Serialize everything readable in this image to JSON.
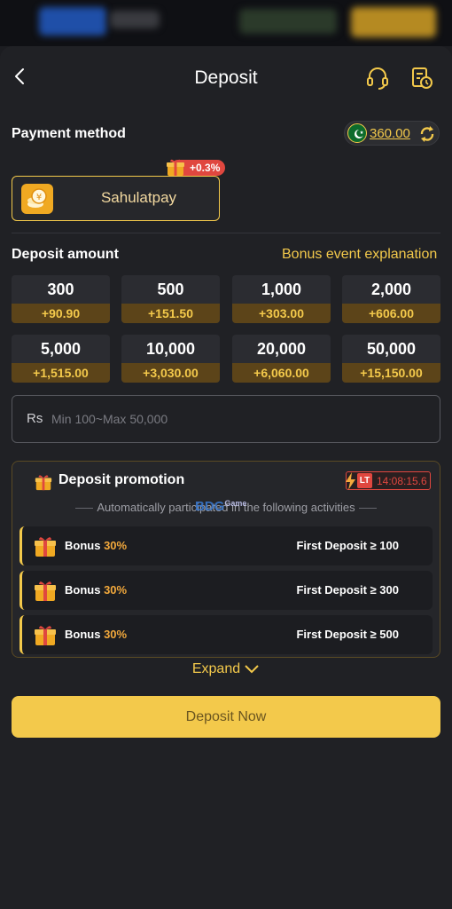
{
  "header": {
    "title": "Deposit"
  },
  "payment": {
    "section_title": "Payment method",
    "balance": "360.00",
    "method_name": "Sahulatpay",
    "rate_badge": "+0.3%"
  },
  "amounts": {
    "section_title": "Deposit amount",
    "bonus_link": "Bonus event explanation",
    "options": [
      {
        "amount": "300",
        "bonus": "+90.90"
      },
      {
        "amount": "500",
        "bonus": "+151.50"
      },
      {
        "amount": "1,000",
        "bonus": "+303.00"
      },
      {
        "amount": "2,000",
        "bonus": "+606.00"
      },
      {
        "amount": "5,000",
        "bonus": "+1,515.00"
      },
      {
        "amount": "10,000",
        "bonus": "+3,030.00"
      },
      {
        "amount": "20,000",
        "bonus": "+6,060.00"
      },
      {
        "amount": "50,000",
        "bonus": "+15,150.00"
      }
    ],
    "input": {
      "currency": "Rs",
      "placeholder": "Min 100~Max 50,000",
      "value": ""
    }
  },
  "promotion": {
    "title": "Deposit promotion",
    "timer_tag": "LT",
    "timer": "14:08:15.6",
    "subtitle": "Automatically participated in the following activities",
    "watermark": "BDG",
    "watermark_small": "Game",
    "rows": [
      {
        "label": "Bonus",
        "percent": "30%",
        "condition": "First Deposit ≥ 100"
      },
      {
        "label": "Bonus",
        "percent": "30%",
        "condition": "First Deposit ≥ 300"
      },
      {
        "label": "Bonus",
        "percent": "30%",
        "condition": "First Deposit ≥ 500"
      }
    ],
    "expand_label": "Expand"
  },
  "actions": {
    "deposit_label": "Deposit Now"
  },
  "colors": {
    "accent": "#f3c94b",
    "background": "#202125",
    "bonus_strip": "#5c4419",
    "alert": "#e0473f"
  },
  "icons": [
    "back-arrow-icon",
    "headset-icon",
    "history-icon",
    "pakistan-flag-icon",
    "refresh-icon",
    "coin-icon",
    "gift-icon",
    "lightning-icon",
    "chevron-down-icon"
  ]
}
